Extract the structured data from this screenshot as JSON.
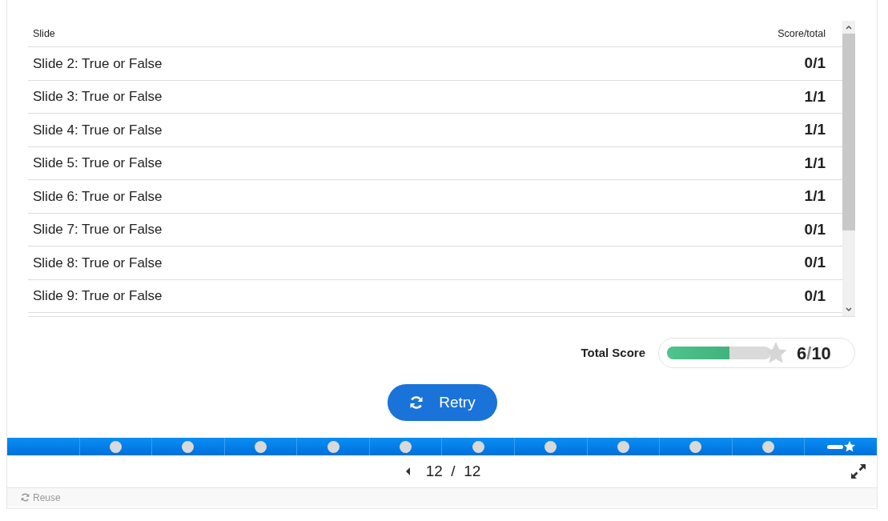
{
  "table": {
    "columns": [
      "Slide",
      "Score/total"
    ],
    "rows": [
      {
        "slide": "Slide 2: True or False",
        "score": "0/1"
      },
      {
        "slide": "Slide 3: True or False",
        "score": "1/1"
      },
      {
        "slide": "Slide 4: True or False",
        "score": "1/1"
      },
      {
        "slide": "Slide 5: True or False",
        "score": "1/1"
      },
      {
        "slide": "Slide 6: True or False",
        "score": "1/1"
      },
      {
        "slide": "Slide 7: True or False",
        "score": "0/1"
      },
      {
        "slide": "Slide 8: True or False",
        "score": "0/1"
      },
      {
        "slide": "Slide 9: True or False",
        "score": "0/1"
      }
    ]
  },
  "total_score": {
    "label": "Total Score",
    "level": 0.6,
    "score": "6",
    "separator": "/",
    "max": "10"
  },
  "retry_button": {
    "label": "Retry"
  },
  "progress_track": [
    {
      "kind": "blank"
    },
    {
      "kind": "dot"
    },
    {
      "kind": "dot"
    },
    {
      "kind": "dot"
    },
    {
      "kind": "dot"
    },
    {
      "kind": "dot"
    },
    {
      "kind": "dot"
    },
    {
      "kind": "dot"
    },
    {
      "kind": "dot"
    },
    {
      "kind": "dot"
    },
    {
      "kind": "dot"
    },
    {
      "kind": "summary"
    }
  ],
  "navigation": {
    "current": "12",
    "separator": "/",
    "total": "12"
  },
  "footer": {
    "reuse": "Reuse"
  }
}
